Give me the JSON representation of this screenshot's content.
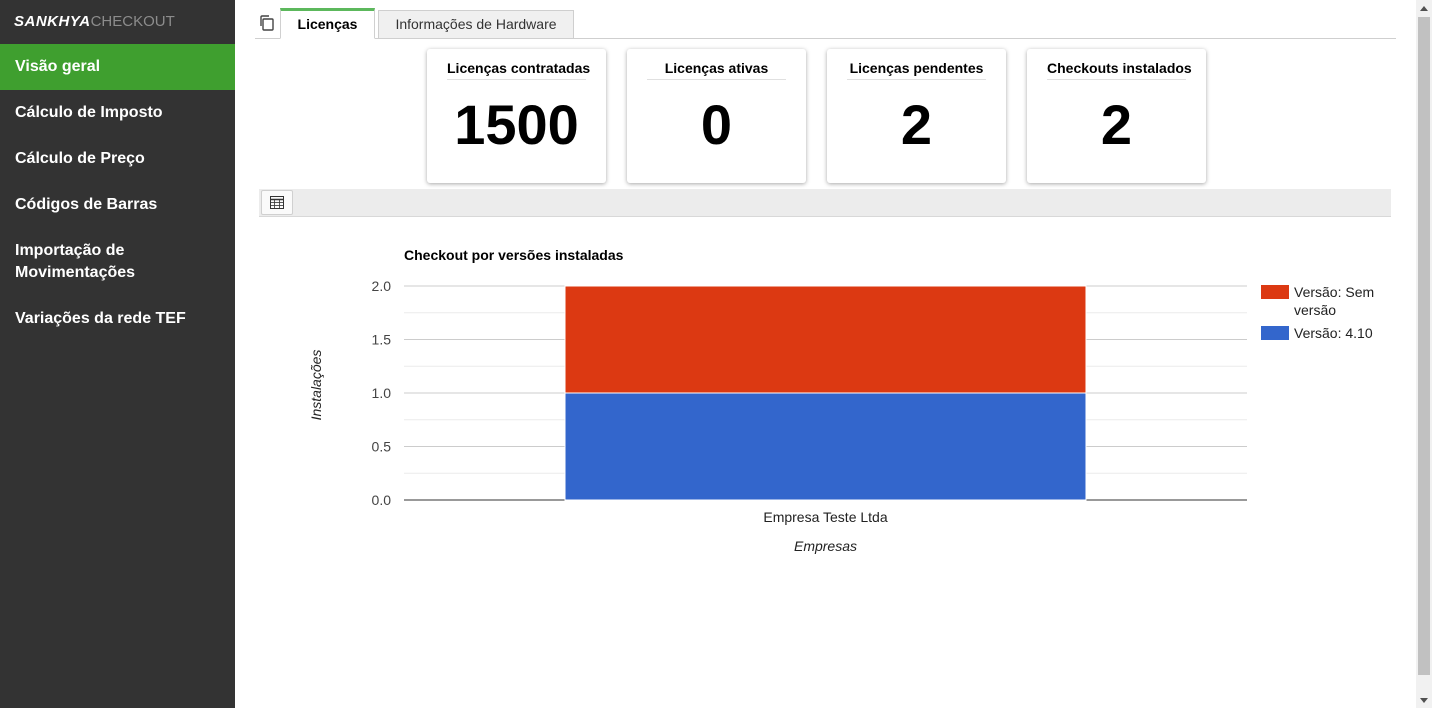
{
  "app": {
    "logo_bold": "SANKHYA",
    "logo_light": "CHECKOUT"
  },
  "sidebar": {
    "items": [
      {
        "label": "Visão geral",
        "active": true
      },
      {
        "label": "Cálculo de Imposto"
      },
      {
        "label": "Cálculo de Preço"
      },
      {
        "label": "Códigos de Barras"
      },
      {
        "label": "Importação de Movimentações"
      },
      {
        "label": "Variações da rede TEF"
      }
    ]
  },
  "tabs": [
    {
      "label": "Licenças",
      "active": true
    },
    {
      "label": "Informações de Hardware"
    }
  ],
  "cards": [
    {
      "title": "Licenças contratadas",
      "value": "1500"
    },
    {
      "title": "Licenças ativas",
      "value": "0"
    },
    {
      "title": "Licenças pendentes",
      "value": "2"
    },
    {
      "title": "Checkouts instalados",
      "value": "2"
    }
  ],
  "colors": {
    "accent": "#3f9f2f",
    "sidebar_bg": "#333333",
    "series_red": "#dc3912",
    "series_blue": "#3366cc"
  },
  "chart_data": {
    "type": "bar",
    "stacked": true,
    "title": "Checkout por versões instaladas",
    "xlabel": "Empresas",
    "ylabel": "Instalações",
    "categories": [
      "Empresa Teste Ltda"
    ],
    "ylim": [
      0,
      2
    ],
    "yticks": [
      "0.0",
      "0.5",
      "1.0",
      "1.5",
      "2.0"
    ],
    "series": [
      {
        "name": "Versão: 4.10",
        "values": [
          1
        ],
        "color": "#3366cc"
      },
      {
        "name": "Versão: Sem versão",
        "values": [
          1
        ],
        "color": "#dc3912"
      }
    ],
    "legend_position": "right",
    "grid": true
  }
}
